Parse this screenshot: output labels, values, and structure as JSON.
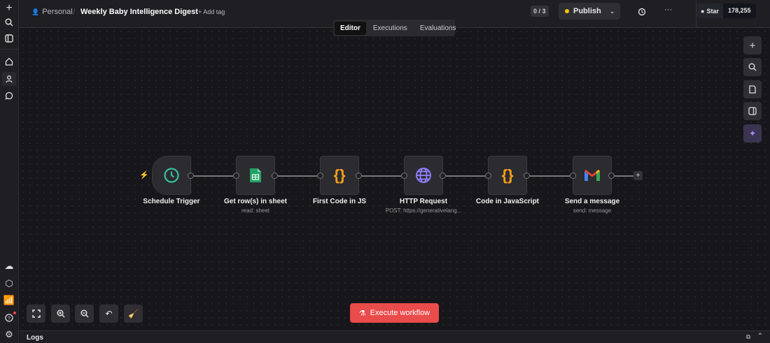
{
  "header": {
    "breadcrumb_project": "Personal",
    "separator": "/",
    "workflow_title": "Weekly Baby Intelligence Digest",
    "add_tag": "+ Add tag",
    "counter": "0 / 3",
    "publish_label": "Publish",
    "github_star": "Star",
    "github_count": "178,255"
  },
  "tabs": [
    {
      "label": "Editor",
      "active": true
    },
    {
      "label": "Executions"
    },
    {
      "label": "Evaluations"
    }
  ],
  "nodes": [
    {
      "label": "Schedule Trigger",
      "subtitle": "",
      "icon": "clock-icon"
    },
    {
      "label": "Get row(s) in sheet",
      "subtitle": "read: sheet",
      "icon": "google-sheets-icon"
    },
    {
      "label": "First Code in JS",
      "subtitle": "",
      "icon": "code-braces-icon"
    },
    {
      "label": "HTTP Request",
      "subtitle": "POST: https://generativelang...",
      "icon": "globe-icon"
    },
    {
      "label": "Code in JavaScript",
      "subtitle": "",
      "icon": "code-braces-icon"
    },
    {
      "label": "Send a message",
      "subtitle": "send: message",
      "icon": "gmail-icon"
    }
  ],
  "execute_label": "Execute workflow",
  "logs_label": "Logs",
  "colors": {
    "accent": "#ea4b4b",
    "publish_dot": "#f5c518",
    "clock": "#35c3a0",
    "braces": "#ff9f1a",
    "globe": "#8b7cf6"
  }
}
